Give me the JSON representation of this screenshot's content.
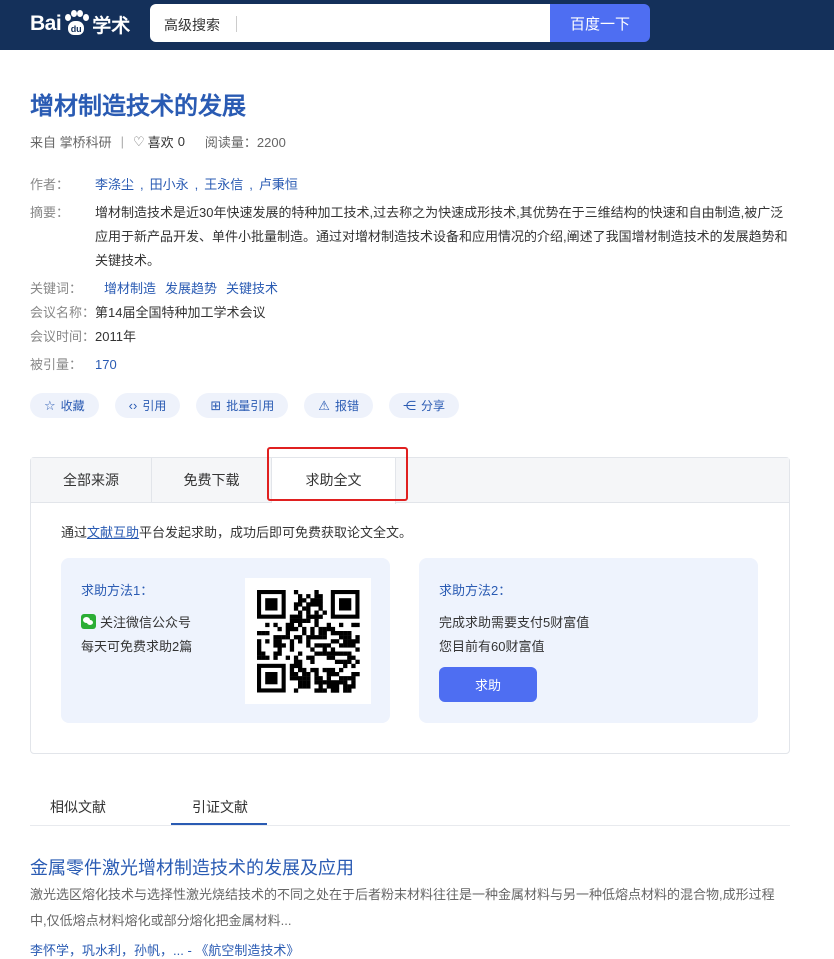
{
  "header": {
    "logo_text_1": "Bai",
    "logo_text_2": "du",
    "logo_text_3": "学术",
    "advanced_search": "高级搜索",
    "search_value": "",
    "search_button": "百度一下"
  },
  "paper": {
    "title": "增材制造技术的发展",
    "source": "来自 掌桥科研",
    "likes_label": "喜欢",
    "likes_count": "0",
    "reads": "阅读量：2200",
    "authors_label": "作者：",
    "authors": [
      "李涤尘",
      "田小永",
      "王永信",
      "卢秉恒"
    ],
    "author_sep": ",",
    "abstract_label": "摘要：",
    "abstract": "增材制造技术是近30年快速发展的特种加工技术,过去称之为快速成形技术,其优势在于三维结构的快速和自由制造,被广泛应用于新产品开发、单件小批量制造。通过对增材制造技术设备和应用情况的介绍,阐述了我国增材制造技术的发展趋势和关键技术。",
    "keywords_label": "关键词：",
    "keywords": [
      "增材制造",
      "发展趋势",
      "关键技术"
    ],
    "conference_label": "会议名称：",
    "conference": "第14届全国特种加工学术会议",
    "conference_time_label": "会议时间：",
    "conference_time": "2011年",
    "cited_label": "被引量：",
    "cited": "170"
  },
  "actions": [
    {
      "label": "收藏",
      "icon": "star-icon"
    },
    {
      "label": "引用",
      "icon": "code-icon"
    },
    {
      "label": "批量引用",
      "icon": "folder-add-icon"
    },
    {
      "label": "报错",
      "icon": "warning-icon"
    },
    {
      "label": "分享",
      "icon": "share-icon"
    }
  ],
  "source_tabs": {
    "tab1": "全部来源",
    "tab2": "免费下载",
    "tab3": "求助全文",
    "intro_prefix": "通过",
    "intro_link": "文献互助",
    "intro_suffix": "平台发起求助，成功后即可免费获取论文全文。"
  },
  "method1": {
    "heading": "求助方法1：",
    "line1": "关注微信公众号",
    "line2": "每天可免费求助2篇"
  },
  "method2": {
    "heading": "求助方法2：",
    "line1": "完成求助需要支付5财富值",
    "line2": "您目前有60财富值",
    "button": "求助"
  },
  "bottom_tabs": {
    "tab1": "相似文献",
    "tab2": "引证文献"
  },
  "result": {
    "title": "金属零件激光增材制造技术的发展及应用",
    "desc": "激光选区熔化技术与选择性激光烧结技术的不同之处在于后者粉末材料往往是一种金属材料与另一种低熔点材料的混合物,成形过程中,仅低熔点材料熔化或部分熔化把金属材料...",
    "authors": "李怀学，巩水利，孙帆，... - 《航空制造技术》"
  },
  "colors": {
    "header_bg": "#14305a",
    "accent": "#4e6ef2",
    "link": "#2a5bb3",
    "highlight_box": "#e02020"
  }
}
